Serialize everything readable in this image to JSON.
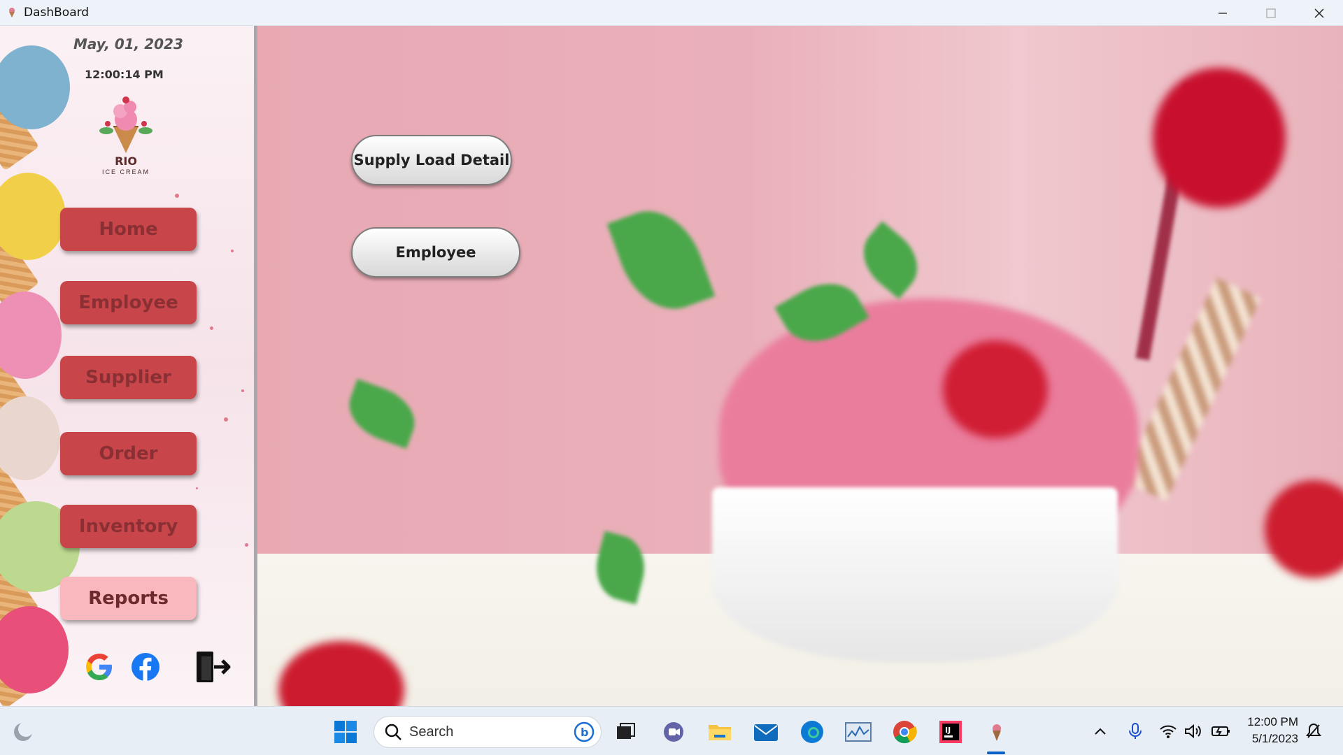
{
  "window": {
    "title": "DashBoard"
  },
  "sidebar": {
    "date": "May,  01, 2023",
    "time": "12:00:14 PM",
    "logo": {
      "name": "RIO",
      "subtitle": "ICE CREAM"
    },
    "nav": [
      {
        "label": "Home",
        "active": false
      },
      {
        "label": "Employee",
        "active": false
      },
      {
        "label": "Supplier",
        "active": false
      },
      {
        "label": "Order",
        "active": false
      },
      {
        "label": "Inventory",
        "active": false
      },
      {
        "label": "Reports",
        "active": true
      }
    ],
    "social": [
      "google-icon",
      "facebook-icon",
      "logout-icon"
    ]
  },
  "main": {
    "buttons": [
      {
        "label": "Supply Load Detail"
      },
      {
        "label": "Employee"
      }
    ]
  },
  "taskbar": {
    "search_placeholder": "Search",
    "clock_time": "12:00 PM",
    "clock_date": "5/1/2023"
  },
  "colors": {
    "nav_button": "#c8454a",
    "nav_active": "#f9b8bd",
    "main_background": "#e8a9b3"
  }
}
